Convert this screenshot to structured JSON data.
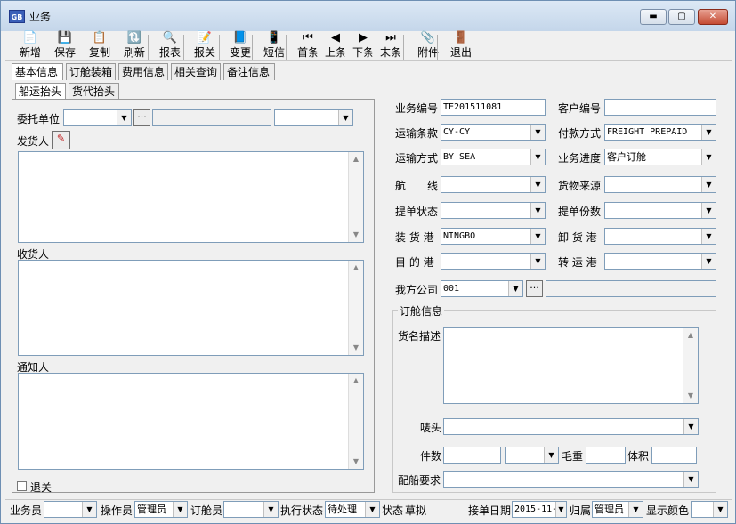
{
  "window": {
    "title": "业务",
    "icon_text": "GB",
    "min": "▬",
    "max": "▢",
    "close": "✕"
  },
  "toolbar": [
    {
      "label": "新增",
      "icon": "📄",
      "name": "new-button"
    },
    {
      "label": "保存",
      "icon": "💾",
      "name": "save-button"
    },
    {
      "label": "复制",
      "icon": "📋",
      "name": "copy-button"
    },
    {
      "label": "刷新",
      "icon": "🔃",
      "name": "refresh-button"
    },
    {
      "label": "报表",
      "icon": "🔍",
      "name": "report-button"
    },
    {
      "label": "报关",
      "icon": "📝",
      "name": "customs-button"
    },
    {
      "label": "变更",
      "icon": "📘",
      "name": "change-button"
    },
    {
      "label": "短信",
      "icon": "📱",
      "name": "sms-button"
    },
    {
      "label": "首条",
      "icon": "⏮",
      "name": "first-button"
    },
    {
      "label": "上条",
      "icon": "◀",
      "name": "prev-button"
    },
    {
      "label": "下条",
      "icon": "▶",
      "name": "next-button"
    },
    {
      "label": "末条",
      "icon": "⏭",
      "name": "last-button"
    },
    {
      "label": "附件",
      "icon": "📎",
      "name": "attach-button"
    },
    {
      "label": "退出",
      "icon": "🚪",
      "name": "exit-button"
    }
  ],
  "tabs": [
    "基本信息",
    "订舱装箱",
    "费用信息",
    "相关查询",
    "备注信息"
  ],
  "subtabs": [
    "船运抬头",
    "货代抬头"
  ],
  "left": {
    "client_label": "委托单位",
    "shipper_label": "发货人",
    "consignee_label": "收货人",
    "notify_label": "通知人",
    "return_label": "退关"
  },
  "right": {
    "job_no_label": "业务编号",
    "job_no": "TE201511081",
    "cust_no_label": "客户编号",
    "cust_no": "",
    "terms_label": "运输条款",
    "terms": "CY-CY",
    "payment_label": "付款方式",
    "payment": "FREIGHT PREPAID",
    "mode_label": "运输方式",
    "mode": "BY SEA",
    "progress_label": "业务进度",
    "progress": "客户订舱",
    "route_label": "航　　线",
    "route": "",
    "source_label": "货物来源",
    "source": "",
    "bl_status_label": "提单状态",
    "bl_status": "",
    "bl_copies_label": "提单份数",
    "bl_copies": "",
    "pol_label": "装 货 港",
    "pol": "NINGBO",
    "pod_label": "卸 货 港",
    "pod": "",
    "dest_label": "目 的 港",
    "dest": "",
    "transit_label": "转 运 港",
    "transit": "",
    "company_label": "我方公司",
    "company": "001"
  },
  "booking": {
    "title": "订舱信息",
    "desc_label": "货名描述",
    "marks_label": "唛头",
    "pieces_label": "件数",
    "gross_label": "毛重",
    "volume_label": "体积",
    "req_label": "配船要求"
  },
  "status": {
    "salesman_label": "业务员",
    "salesman": "",
    "operator_label": "操作员",
    "operator": "管理员",
    "booker_label": "订舱员",
    "booker": "",
    "exec_label": "执行状态",
    "exec": "待处理",
    "state_label": "状态",
    "state": "草拟",
    "date_label": "接单日期",
    "date": "2015-11-",
    "owner_label": "归属",
    "owner": "管理员",
    "color_label": "显示颜色"
  },
  "icons": {
    "dropdown": "▼",
    "scroll_up": "▲",
    "scroll_down": "▼",
    "ellipsis": "···",
    "shipper_pick": "✎"
  }
}
